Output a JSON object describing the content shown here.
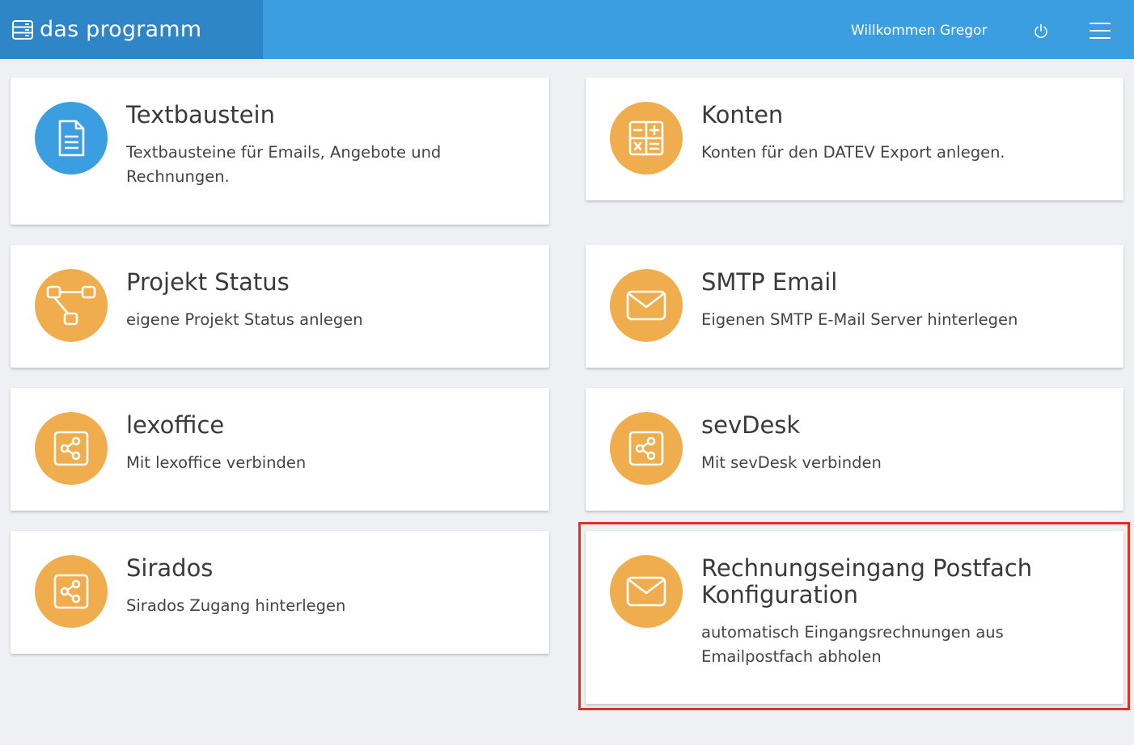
{
  "header": {
    "brand": "das programm",
    "brand_icon": "server-icon",
    "welcome": "Willkommen Gregor",
    "power_icon": "power-icon",
    "menu_icon": "hamburger-menu-icon"
  },
  "cards": [
    {
      "id": "textbaustein",
      "title": "Textbaustein",
      "desc_lines": [
        "Textbausteine für Emails, Angebote und",
        "Rechnungen."
      ],
      "icon": "document-icon",
      "color": "#3a9ee0"
    },
    {
      "id": "konten",
      "title": "Konten",
      "desc_lines": [
        "Konten für den DATEV Export anlegen."
      ],
      "icon": "calculator-icon",
      "color": "#f0ad4e"
    },
    {
      "id": "projekt-status",
      "title": "Projekt Status",
      "desc_lines": [
        "eigene Projekt Status anlegen"
      ],
      "icon": "workflow-icon",
      "color": "#f0ad4e"
    },
    {
      "id": "smtp-email",
      "title": "SMTP Email",
      "desc_lines": [
        "Eigenen SMTP E-Mail Server hinterlegen"
      ],
      "icon": "envelope-icon",
      "color": "#f0ad4e"
    },
    {
      "id": "lexoffice",
      "title": "lexoffice",
      "desc_lines": [
        "Mit lexoffice verbinden"
      ],
      "icon": "share-icon",
      "color": "#f0ad4e"
    },
    {
      "id": "sevdesk",
      "title": "sevDesk",
      "desc_lines": [
        "Mit sevDesk verbinden"
      ],
      "icon": "share-icon",
      "color": "#f0ad4e"
    },
    {
      "id": "sirados",
      "title": "Sirados",
      "desc_lines": [
        "Sirados Zugang hinterlegen"
      ],
      "icon": "share-icon",
      "color": "#f0ad4e"
    },
    {
      "id": "rechnungseingang",
      "title_lines": [
        "Rechnungseingang Postfach",
        "Konfiguration"
      ],
      "desc_lines": [
        "automatisch Eingangsrechnungen aus",
        "Emailpostfach abholen"
      ],
      "icon": "envelope-icon",
      "color": "#f0ad4e",
      "highlighted": true
    }
  ]
}
